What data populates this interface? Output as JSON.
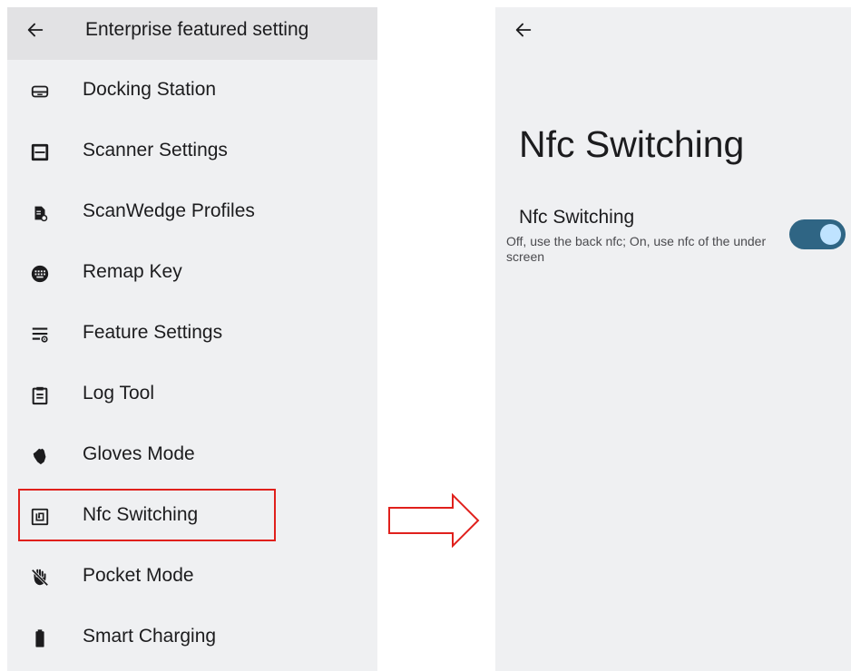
{
  "left_screen": {
    "title": "Enterprise featured setting",
    "back_icon": "arrow-left-icon",
    "items": [
      {
        "label": "Docking Station",
        "icon": "docking-station-icon"
      },
      {
        "label": "Scanner Settings",
        "icon": "scanner-icon"
      },
      {
        "label": "ScanWedge Profiles",
        "icon": "scanwedge-profile-icon"
      },
      {
        "label": "Remap Key",
        "icon": "keyboard-icon"
      },
      {
        "label": "Feature Settings",
        "icon": "feature-settings-icon"
      },
      {
        "label": "Log Tool",
        "icon": "clipboard-icon"
      },
      {
        "label": "Gloves Mode",
        "icon": "glove-icon"
      },
      {
        "label": "Nfc Switching",
        "icon": "nfc-icon",
        "highlighted": true
      },
      {
        "label": "Pocket Mode",
        "icon": "hand-off-icon"
      },
      {
        "label": "Smart Charging",
        "icon": "battery-icon"
      }
    ]
  },
  "annotation": {
    "highlight_color": "#e0201c",
    "arrow_icon": "right-arrow-outline-icon"
  },
  "right_screen": {
    "back_icon": "arrow-left-icon",
    "heading": "Nfc Switching",
    "setting": {
      "title": "Nfc Switching",
      "summary": "Off, use the back nfc; On, use nfc of the under screen",
      "toggle_on": true
    }
  },
  "colors": {
    "screen_bg": "#eff0f2",
    "topbar_bg": "#e2e2e4",
    "toggle_track": "#2f6584",
    "toggle_knob": "#bfe3ff"
  }
}
